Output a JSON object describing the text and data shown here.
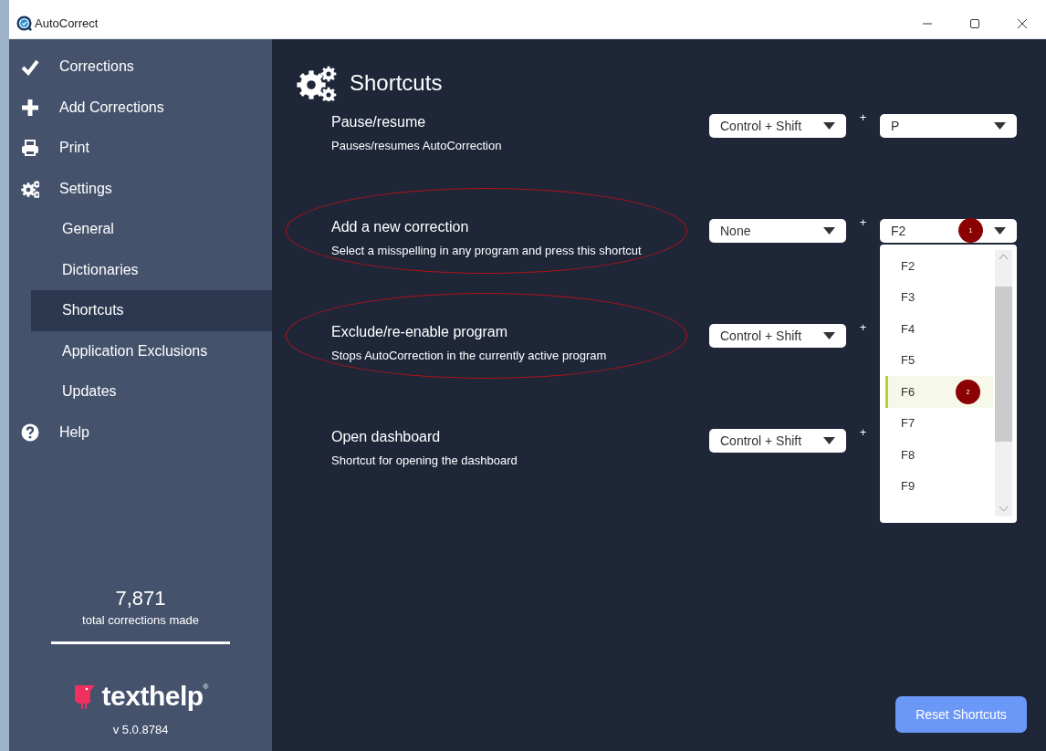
{
  "window": {
    "title": "AutoCorrect"
  },
  "sidebar": {
    "items": [
      {
        "label": "Corrections"
      },
      {
        "label": "Add Corrections"
      },
      {
        "label": "Print"
      },
      {
        "label": "Settings",
        "children": [
          {
            "label": "General",
            "selected": false
          },
          {
            "label": "Dictionaries",
            "selected": false
          },
          {
            "label": "Shortcuts",
            "selected": true
          },
          {
            "label": "Application Exclusions",
            "selected": false
          },
          {
            "label": "Updates",
            "selected": false
          }
        ]
      },
      {
        "label": "Help"
      }
    ],
    "stats": {
      "count": "7,871",
      "label": "total corrections made"
    },
    "brand": {
      "name": "texthelp",
      "mark": "®"
    },
    "version": "v 5.0.8784"
  },
  "page": {
    "title": "Shortcuts"
  },
  "shortcuts": [
    {
      "title": "Pause/resume",
      "description": "Pauses/resumes AutoCorrection",
      "modifier": "Control + Shift",
      "plus": "+",
      "key": "P",
      "circled": false
    },
    {
      "title": "Add a new correction",
      "description": "Select a misspelling in any program and press this shortcut",
      "modifier": "None",
      "plus": "+",
      "key": "F2",
      "circled": true,
      "marker": "1",
      "open": true
    },
    {
      "title": "Exclude/re-enable program",
      "description": "Stops AutoCorrection in the currently active program",
      "modifier": "Control + Shift",
      "plus": "+",
      "circled": true
    },
    {
      "title": "Open dashboard",
      "description": "Shortcut for opening the dashboard",
      "modifier": "Control + Shift",
      "plus": "+",
      "circled": false
    }
  ],
  "dropdown_options": [
    {
      "label": "F2",
      "selected": false
    },
    {
      "label": "F3",
      "selected": false
    },
    {
      "label": "F4",
      "selected": false
    },
    {
      "label": "F5",
      "selected": false
    },
    {
      "label": "F6",
      "selected": true,
      "marker": "2"
    },
    {
      "label": "F7",
      "selected": false
    },
    {
      "label": "F8",
      "selected": false
    },
    {
      "label": "F9",
      "selected": false
    }
  ],
  "reset_button": "Reset Shortcuts"
}
